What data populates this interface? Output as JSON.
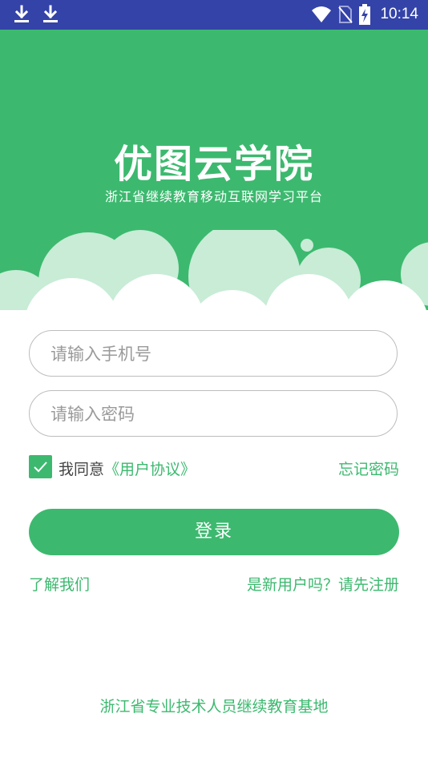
{
  "status_bar": {
    "time": "10:14",
    "icons": [
      "download-icon",
      "download-icon",
      "wifi-icon",
      "no-sim-icon",
      "battery-charging-icon"
    ]
  },
  "header": {
    "logo_text": "优图云学院",
    "subtitle": "浙江省继续教育移动互联网学习平台"
  },
  "form": {
    "phone_placeholder": "请输入手机号",
    "password_placeholder": "请输入密码",
    "agree_prefix": "我同意",
    "agree_link": "《用户协议》",
    "agree_checked": true,
    "forgot_password": "忘记密码",
    "login_label": "登录"
  },
  "links": {
    "about": "了解我们",
    "register": "是新用户吗？请先注册"
  },
  "footer": {
    "text": "浙江省专业技术人员继续教育基地"
  },
  "colors": {
    "primary": "#3cb96f",
    "status_bar": "#3443a8",
    "cloud_light": "#c8ecd6"
  }
}
